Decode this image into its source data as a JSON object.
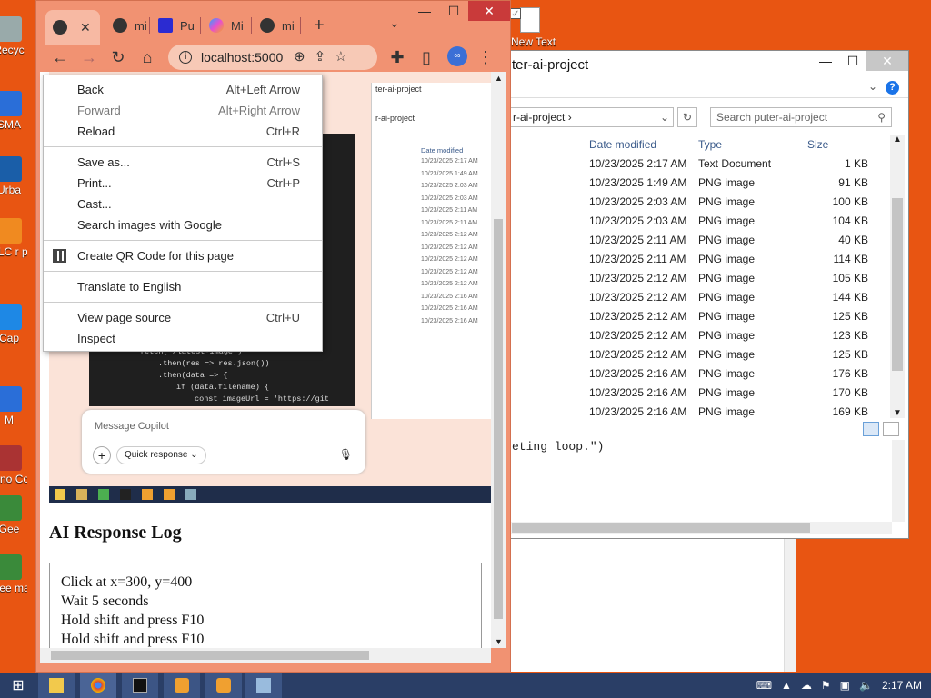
{
  "desktop": {
    "icons": [
      {
        "label": "Recyc",
        "icon": "recycle-bin-icon"
      },
      {
        "label": "SMA",
        "icon": "app-icon"
      },
      {
        "label": "Urba",
        "icon": "app-icon"
      },
      {
        "label": "VLC r pla",
        "icon": "vlc-icon"
      },
      {
        "label": "Cap",
        "icon": "capture-icon"
      },
      {
        "label": "M",
        "icon": "app-icon"
      },
      {
        "label": "Inno Con",
        "icon": "inno-icon"
      },
      {
        "label": "Gee",
        "icon": "geek-icon"
      },
      {
        "label": "Gee ma",
        "icon": "geek-icon"
      }
    ],
    "new_text_label": "New Text"
  },
  "browser": {
    "tabs": [
      {
        "label": "",
        "icon": "chrome-icon",
        "active": true
      },
      {
        "label": "mi",
        "icon": "github-icon"
      },
      {
        "label": "Pu",
        "icon": "puter-icon"
      },
      {
        "label": "Mi",
        "icon": "copilot-icon"
      },
      {
        "label": "mi",
        "icon": "github-icon"
      }
    ],
    "new_tab_symbol": "+",
    "url": "localhost:5000",
    "context_menu": {
      "groups": [
        [
          {
            "label": "Back",
            "shortcut": "Alt+Left Arrow",
            "disabled": false
          },
          {
            "label": "Forward",
            "shortcut": "Alt+Right Arrow",
            "disabled": true
          },
          {
            "label": "Reload",
            "shortcut": "Ctrl+R",
            "disabled": false
          }
        ],
        [
          {
            "label": "Save as...",
            "shortcut": "Ctrl+S",
            "disabled": false
          },
          {
            "label": "Print...",
            "shortcut": "Ctrl+P",
            "disabled": false
          },
          {
            "label": "Cast...",
            "shortcut": "",
            "disabled": false
          },
          {
            "label": "Search images with Google",
            "shortcut": "",
            "disabled": false
          }
        ],
        [
          {
            "label": "Create QR Code for this page",
            "shortcut": "",
            "disabled": false
          }
        ],
        [
          {
            "label": "Translate to English",
            "shortcut": "",
            "disabled": false
          }
        ],
        [
          {
            "label": "View page source",
            "shortcut": "Ctrl+U",
            "disabled": false
          },
          {
            "label": "Inspect",
            "shortcut": "",
            "disabled": false
          }
        ]
      ]
    },
    "page": {
      "screenshot": {
        "copilot_placeholder": "Message Copilot",
        "quick_response": "Quick response",
        "explorer_title": "ter-ai-project",
        "explorer_path": "r-ai-project",
        "date_header": "Date modified",
        "dates": [
          "10/23/2025 2:17 AM",
          "10/23/2025 1:49 AM",
          "10/23/2025 2:03 AM",
          "10/23/2025 2:03 AM",
          "10/23/2025 2:11 AM",
          "10/23/2025 2:11 AM",
          "10/23/2025 2:12 AM",
          "10/23/2025 2:12 AM",
          "10/23/2025 2:12 AM",
          "10/23/2025 2:12 AM",
          "10/23/2025 2:12 AM",
          "10/23/2025 2:16 AM",
          "10/23/2025 2:16 AM",
          "10/23/2025 2:16 AM"
        ],
        "code_lines": [
          "fetch('/latest-image')",
          ".then(res => res.json())",
          ".then(data => {",
          "if (data.filename) {",
          "const imageUrl = 'https://git"
        ]
      },
      "ai_log_title": "AI Response Log",
      "log_lines": [
        "Click at x=300, y=400",
        "Wait 5 seconds",
        "Hold shift and press F10",
        "Hold shift and press F10"
      ]
    }
  },
  "explorer": {
    "title": "ter-ai-project",
    "path": "r-ai-project",
    "search_placeholder": "Search puter-ai-project",
    "columns": {
      "date": "Date modified",
      "type": "Type",
      "size": "Size"
    },
    "rows": [
      {
        "date": "10/23/2025 2:17 AM",
        "type": "Text Document",
        "size": "1 KB"
      },
      {
        "date": "10/23/2025 1:49 AM",
        "type": "PNG image",
        "size": "91 KB"
      },
      {
        "date": "10/23/2025 2:03 AM",
        "type": "PNG image",
        "size": "100 KB"
      },
      {
        "date": "10/23/2025 2:03 AM",
        "type": "PNG image",
        "size": "104 KB"
      },
      {
        "date": "10/23/2025 2:11 AM",
        "type": "PNG image",
        "size": "40 KB"
      },
      {
        "date": "10/23/2025 2:11 AM",
        "type": "PNG image",
        "size": "114 KB"
      },
      {
        "date": "10/23/2025 2:12 AM",
        "type": "PNG image",
        "size": "105 KB"
      },
      {
        "date": "10/23/2025 2:12 AM",
        "type": "PNG image",
        "size": "144 KB"
      },
      {
        "date": "10/23/2025 2:12 AM",
        "type": "PNG image",
        "size": "125 KB"
      },
      {
        "date": "10/23/2025 2:12 AM",
        "type": "PNG image",
        "size": "123 KB"
      },
      {
        "date": "10/23/2025 2:12 AM",
        "type": "PNG image",
        "size": "125 KB"
      },
      {
        "date": "10/23/2025 2:16 AM",
        "type": "PNG image",
        "size": "176 KB"
      },
      {
        "date": "10/23/2025 2:16 AM",
        "type": "PNG image",
        "size": "170 KB"
      },
      {
        "date": "10/23/2025 2:16 AM",
        "type": "PNG image",
        "size": "169 KB"
      }
    ],
    "lower_text": "eting loop.\")"
  },
  "taskbar": {
    "clock": "2:17 AM",
    "apps": [
      "file-explorer-icon",
      "chrome-icon",
      "terminal-icon",
      "app-icon",
      "app-icon",
      "notepad-icon"
    ]
  },
  "colors": {
    "desktop": "#e85512",
    "taskbar": "#2a3e66",
    "browser_frame": "#f19272"
  }
}
